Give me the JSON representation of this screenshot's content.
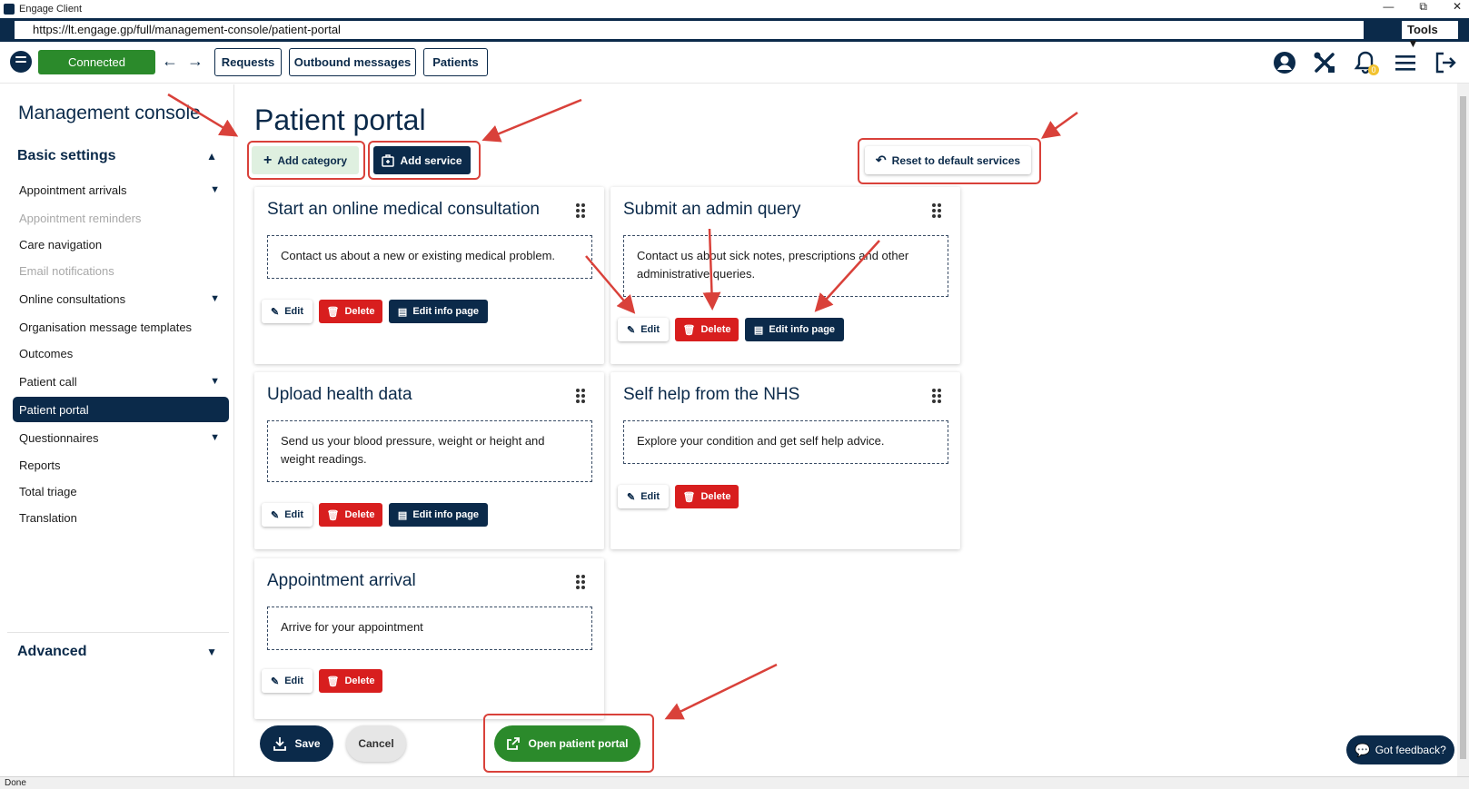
{
  "window": {
    "title": "Engage Client",
    "url": "https://lt.engage.gp/full/management-console/patient-portal",
    "tools_label": "Tools"
  },
  "toolbar": {
    "status": "Connected",
    "nav_buttons": [
      "Requests",
      "Outbound messages",
      "Patients"
    ],
    "notification_count": "0"
  },
  "sidebar": {
    "title": "Management console",
    "section_basic": "Basic settings",
    "items": [
      {
        "label": "Appointment arrivals"
      },
      {
        "label": "Appointment reminders"
      },
      {
        "label": "Care navigation"
      },
      {
        "label": "Email notifications"
      },
      {
        "label": "Online consultations"
      },
      {
        "label": "Organisation message templates"
      },
      {
        "label": "Outcomes"
      },
      {
        "label": "Patient call"
      },
      {
        "label": "Patient portal"
      },
      {
        "label": "Questionnaires"
      },
      {
        "label": "Reports"
      },
      {
        "label": "Total triage"
      },
      {
        "label": "Translation"
      }
    ],
    "section_advanced": "Advanced"
  },
  "main": {
    "title": "Patient portal",
    "add_category": "Add category",
    "add_service": "Add service",
    "reset": "Reset to default services",
    "edit_label": "Edit",
    "delete_label": "Delete",
    "edit_info_label": "Edit info page",
    "cards": [
      {
        "title": "Start an online medical consultation",
        "description": "Contact us about a new or existing medical problem."
      },
      {
        "title": "Submit an admin query",
        "description": "Contact us about sick notes, prescriptions and other administrative queries."
      },
      {
        "title": "Upload health data",
        "description": "Send us your blood pressure, weight or height and weight readings."
      },
      {
        "title": "Self help from the NHS",
        "description": "Explore your condition and get self help advice."
      },
      {
        "title": "Appointment arrival",
        "description": "Arrive for your appointment"
      }
    ],
    "save": "Save",
    "cancel": "Cancel",
    "open_portal": "Open patient portal"
  },
  "feedback": "Got feedback?",
  "status_bar": "Done",
  "colors": {
    "brand_navy": "#0b2a4a",
    "connected_green": "#2b8a2b",
    "delete_red": "#d81e1e",
    "annotation_red": "#d9413a"
  }
}
